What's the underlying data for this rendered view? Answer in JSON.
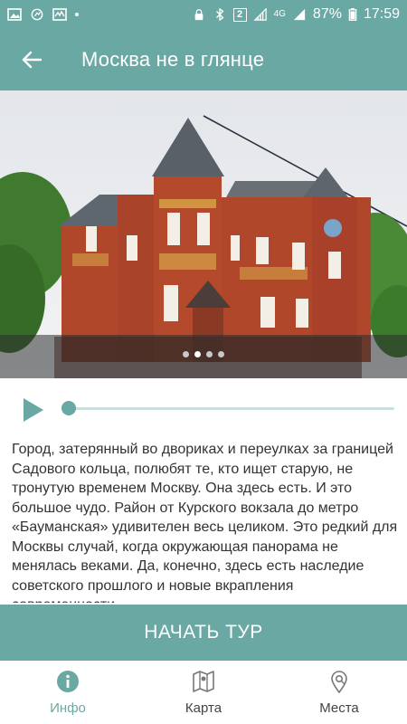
{
  "status_bar": {
    "battery": "87%",
    "time": "17:59",
    "network": "4G",
    "sim_badge": "2"
  },
  "appbar": {
    "title": "Москва не в глянце",
    "back_icon": "arrow-left-icon"
  },
  "hero": {
    "slide_count": 4,
    "active_slide": 1
  },
  "player": {
    "progress": 0
  },
  "description": {
    "text": "Город, затерянный во двориках и переулках за границей Садового кольца, полюбят те, кто ищет старую, не тронутую временем Москву. Она здесь есть. И это большое чудо. Район от Курского вокзала до метро «Бауманская» удивителен весь целиком. Это редкий для Москвы случай, когда окружающая панорама не менялась веками. Да, конечно, здесь есть наследие советского прошлого и новые вкрапления современности."
  },
  "start_button": {
    "label": "НАЧАТЬ ТУР"
  },
  "bottom_nav": {
    "items": [
      {
        "label": "Инфо",
        "icon": "info-icon",
        "active": true
      },
      {
        "label": "Карта",
        "icon": "map-icon",
        "active": false
      },
      {
        "label": "Места",
        "icon": "place-pin-icon",
        "active": false
      }
    ]
  },
  "colors": {
    "accent": "#6aa8a3",
    "track": "#c7e0dd"
  }
}
